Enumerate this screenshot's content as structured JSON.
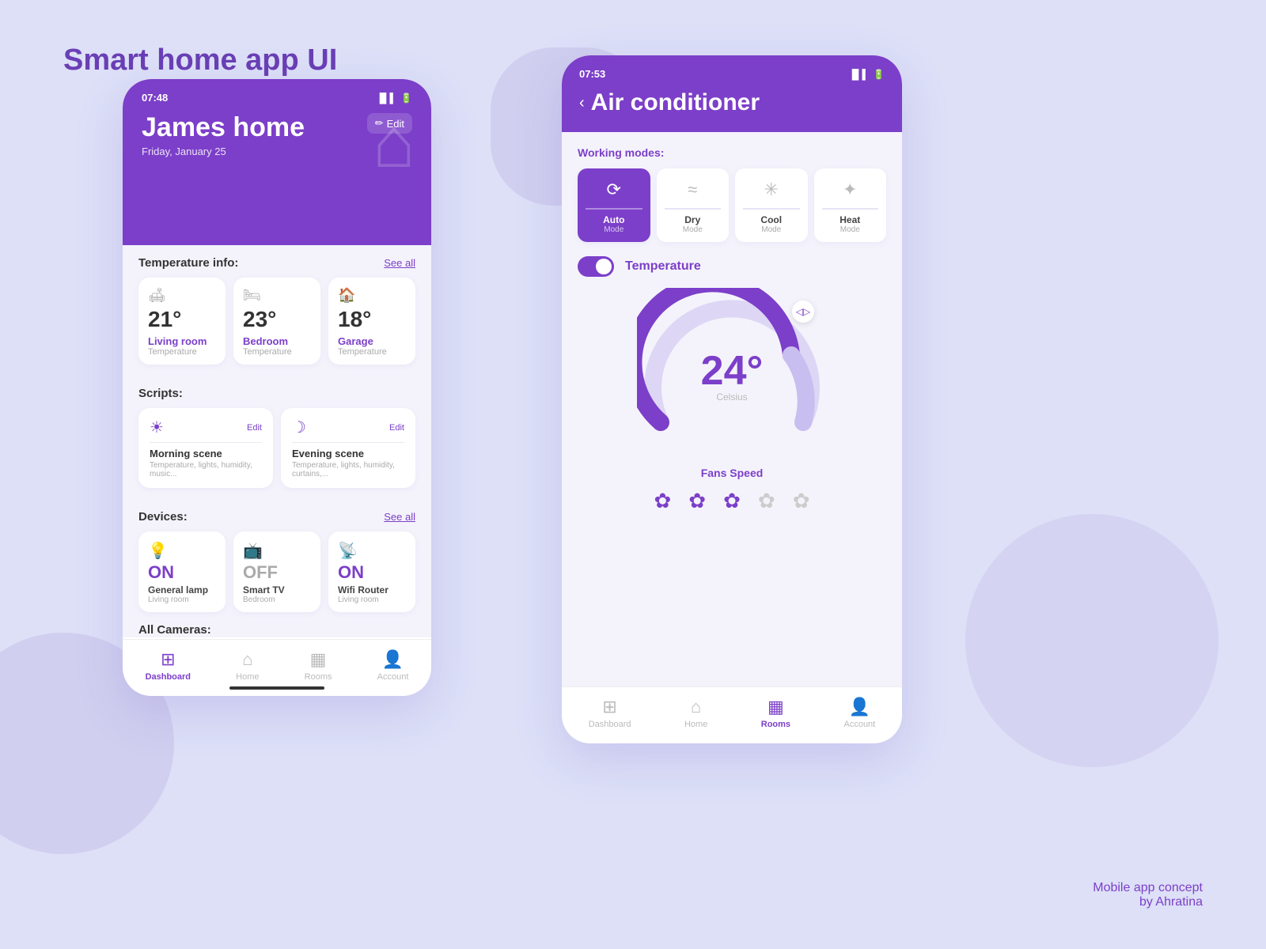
{
  "page": {
    "title": "Smart home app UI",
    "subtitle": "Mobile app concept\nby Ahratina"
  },
  "phone1": {
    "status_bar": {
      "time": "07:48"
    },
    "header": {
      "home_name": "James home",
      "date": "Friday, January 25",
      "edit_label": "Edit"
    },
    "temp_section": {
      "title": "Temperature info:",
      "see_all": "See all",
      "cards": [
        {
          "value": "21°",
          "room": "Living room",
          "label": "Temperature"
        },
        {
          "value": "23°",
          "room": "Bedroom",
          "label": "Temperature"
        },
        {
          "value": "18°",
          "room": "Garage",
          "label": "Temperature"
        }
      ]
    },
    "scripts_section": {
      "title": "Scripts:",
      "cards": [
        {
          "name": "Morning scene",
          "desc": "Temperature, lights, humidity, music...",
          "edit": "Edit"
        },
        {
          "name": "Evening scene",
          "desc": "Temperature, lights, humidity, curtains,...",
          "edit": "Edit"
        }
      ]
    },
    "devices_section": {
      "title": "Devices:",
      "see_all": "See all",
      "cards": [
        {
          "status": "ON",
          "name": "General lamp",
          "room": "Living room"
        },
        {
          "status": "OFF",
          "name": "Smart TV",
          "room": "Bedroom"
        },
        {
          "status": "ON",
          "name": "Wifi Router",
          "room": "Living room"
        }
      ]
    },
    "cameras_section": {
      "title": "All Cameras:"
    },
    "bottom_nav": [
      {
        "label": "Dashboard",
        "active": true
      },
      {
        "label": "Home",
        "active": false
      },
      {
        "label": "Rooms",
        "active": false
      },
      {
        "label": "Account",
        "active": false
      }
    ]
  },
  "phone2": {
    "status_bar": {
      "time": "07:53"
    },
    "header": {
      "back": "‹",
      "title": "Air conditioner"
    },
    "working_modes": {
      "title": "Working modes:",
      "modes": [
        {
          "name": "Auto",
          "sub": "Mode",
          "active": true,
          "icon": "⟳"
        },
        {
          "name": "Dry",
          "sub": "Mode",
          "active": false,
          "icon": "≈"
        },
        {
          "name": "Cool",
          "sub": "Mode",
          "active": false,
          "icon": "✳"
        },
        {
          "name": "Heat",
          "sub": "Mode",
          "active": false,
          "icon": "✦"
        }
      ]
    },
    "temperature": {
      "label": "Temperature",
      "value": "24°",
      "unit": "Celsius",
      "enabled": true
    },
    "fans_speed": {
      "title": "Fans Speed",
      "levels": [
        {
          "active": true
        },
        {
          "active": true
        },
        {
          "active": true
        },
        {
          "active": false
        },
        {
          "active": false
        }
      ]
    },
    "bottom_nav": [
      {
        "label": "Dashboard",
        "active": false
      },
      {
        "label": "Home",
        "active": false
      },
      {
        "label": "Rooms",
        "active": true
      },
      {
        "label": "Account",
        "active": false
      }
    ]
  }
}
